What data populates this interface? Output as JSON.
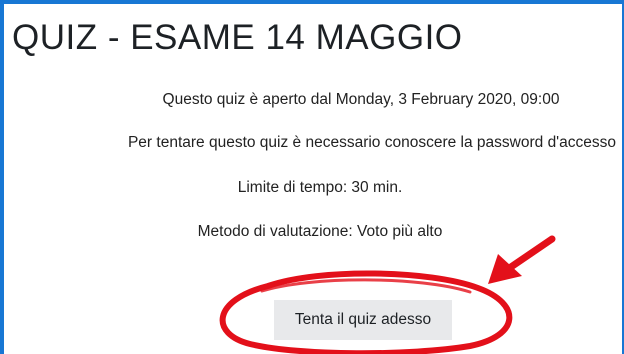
{
  "quiz": {
    "title": "QUIZ - ESAME 14 MAGGIO",
    "open_info": "Questo quiz è aperto dal Monday, 3 February 2020, 09:00",
    "password_info": "Per tentare questo quiz è necessario conoscere la password d'accesso",
    "time_limit": "Limite di tempo: 30 min.",
    "grading_method": "Metodo di valutazione: Voto più alto",
    "attempt_button_label": "Tenta il quiz adesso"
  },
  "colors": {
    "frame_border": "#1877d4",
    "button_bg": "#e8e9eb",
    "annotation_red": "#e3101a"
  },
  "annotations": [
    "red-arrow-icon",
    "red-circle-highlight"
  ]
}
